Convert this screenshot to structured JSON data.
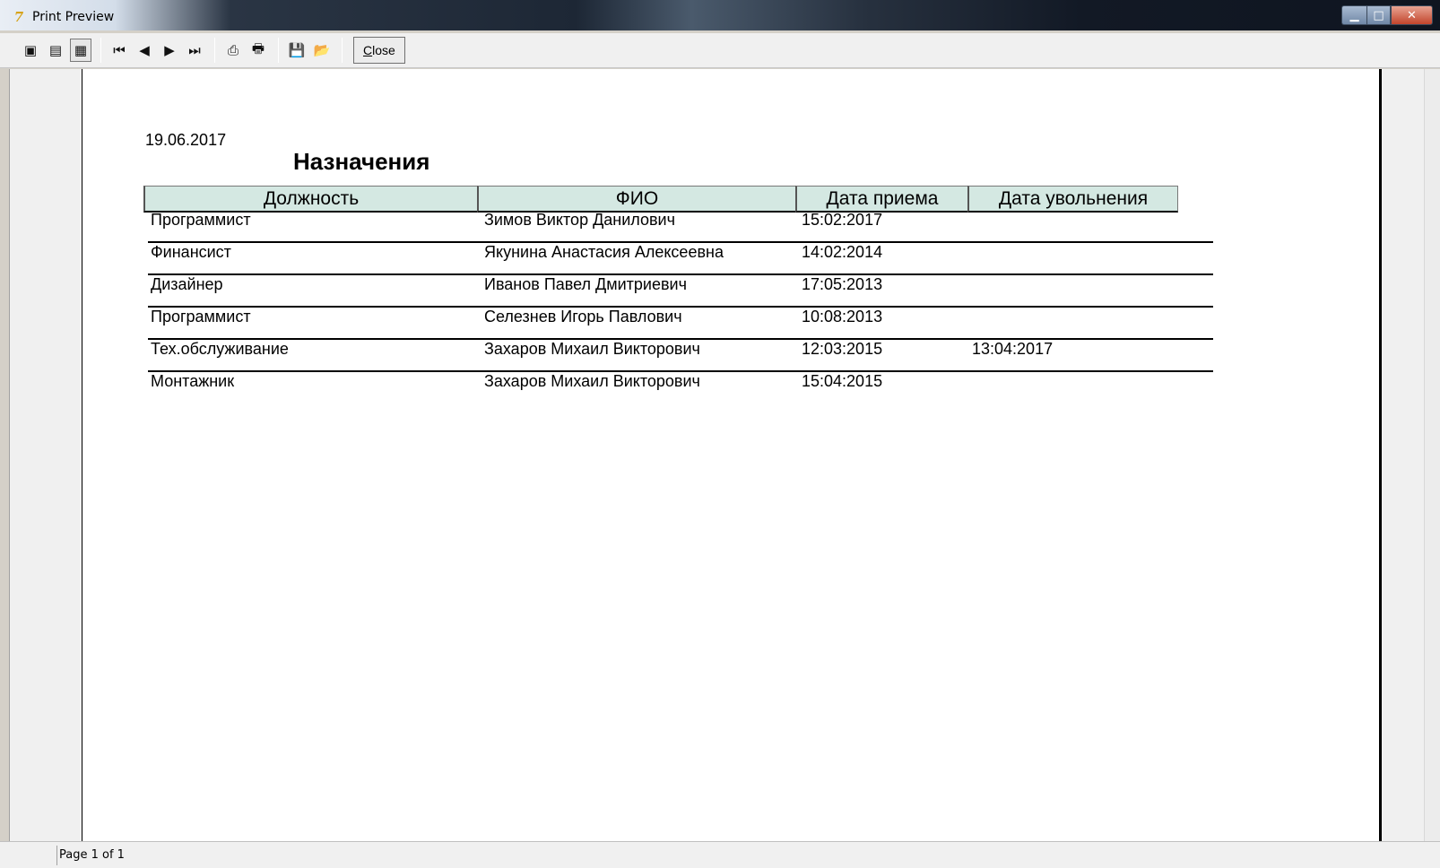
{
  "window": {
    "title": "Print Preview",
    "app_icon": "delphi-icon"
  },
  "toolbar": {
    "buttons": [
      {
        "name": "whole-page-icon",
        "glyph": "▣"
      },
      {
        "name": "page-width-icon",
        "glyph": "▤"
      },
      {
        "name": "zoom-100-icon",
        "glyph": "▦"
      },
      {
        "name": "first-page-icon",
        "glyph": "⏮"
      },
      {
        "name": "prior-page-icon",
        "glyph": "◀"
      },
      {
        "name": "next-page-icon",
        "glyph": "▶"
      },
      {
        "name": "last-page-icon",
        "glyph": "⏭"
      },
      {
        "name": "printer-setup-icon",
        "glyph": "⎙"
      },
      {
        "name": "print-icon",
        "glyph": "🖶"
      },
      {
        "name": "save-icon",
        "glyph": "💾"
      },
      {
        "name": "open-icon",
        "glyph": "📂"
      }
    ],
    "close_label_underlined": "C",
    "close_label_rest": "lose"
  },
  "report": {
    "date": "19.06.2017",
    "title": "Назначения",
    "columns": [
      "Должность",
      "ФИО",
      "Дата приема",
      "Дата увольнения"
    ],
    "rows": [
      [
        "Программист",
        "Зимов Виктор Данилович",
        "15:02:2017",
        ""
      ],
      [
        "Финансист",
        "Якунина Анастасия Алексеевна",
        "14:02:2014",
        ""
      ],
      [
        "Дизайнер",
        "Иванов Павел Дмитриевич",
        "17:05:2013",
        ""
      ],
      [
        "Программист",
        "Селезнев Игорь Павлович",
        "10:08:2013",
        ""
      ],
      [
        "Тех.обслуживание",
        "Захаров Михаил Викторович",
        "12:03:2015",
        "13:04:2017"
      ],
      [
        "Монтажник",
        "Захаров Михаил Викторович",
        "15:04:2015",
        ""
      ]
    ]
  },
  "status": {
    "page_info": "Page 1 of 1"
  }
}
